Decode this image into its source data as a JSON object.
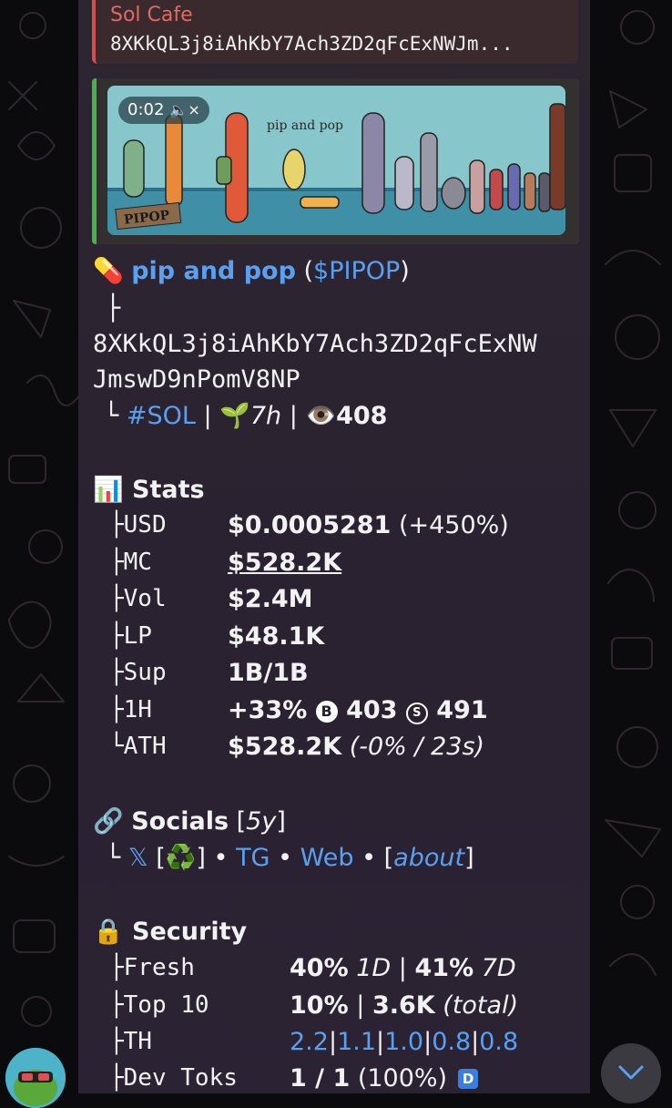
{
  "reply": {
    "name": "Sol Cafe",
    "text": "8XKkQL3j8iAhKbY7Ach3ZD2qFcExNWJm..."
  },
  "media": {
    "duration": "0:02",
    "mute_glyph": "🔈×",
    "image_caption": "pip and pop",
    "image_logo": "PIPOP"
  },
  "token": {
    "emoji": "💊",
    "name": "pip and pop",
    "open_paren": "(",
    "ticker": "$PIPOP",
    "close_paren": ")",
    "tree_first": "├",
    "address_line1": "8XKkQL3j8iAhKbY7Ach3ZD2qFcExNW",
    "address_line2": "JmswD9nPomV8NP",
    "tree_last": "└",
    "chain": "#SOL",
    "sep": "|",
    "age_emoji": "🌱",
    "age": "7h",
    "views_emoji": "👁️",
    "views": "408"
  },
  "stats": {
    "emoji": "📊",
    "title": "Stats",
    "rows": [
      {
        "branch": "├",
        "label": "USD",
        "value": "$0.0005281",
        "extra": "(+450%)"
      },
      {
        "branch": "├",
        "label": "MC",
        "value": "$528.2K",
        "extra": ""
      },
      {
        "branch": "├",
        "label": "Vol",
        "value": "$2.4M",
        "extra": ""
      },
      {
        "branch": "├",
        "label": "LP",
        "value": "$48.1K",
        "extra": ""
      },
      {
        "branch": "├",
        "label": "Sup",
        "value": "1B/1B",
        "extra": ""
      }
    ],
    "h1": {
      "branch": "├",
      "label": "1H",
      "change": "+33%",
      "buy_icon": "B",
      "buys": "403",
      "sell_icon": "S",
      "sells": "491"
    },
    "ath": {
      "branch": "└",
      "label": "ATH",
      "value": "$528.2K",
      "extra": "(-0% / 23s)"
    }
  },
  "socials": {
    "emoji": "🔗",
    "title": "Socials",
    "age_open": "[",
    "age": "5y",
    "age_close": "]",
    "branch": "└",
    "x": "𝕏",
    "recycle_open": "[",
    "recycle": "♻️",
    "recycle_close": "]",
    "dot": "•",
    "tg": "TG",
    "web": "Web",
    "about_open": "[",
    "about": "about",
    "about_close": "]"
  },
  "security": {
    "emoji": "🔒",
    "title": "Security",
    "fresh": {
      "branch": "├",
      "label": "Fresh",
      "v1": "40%",
      "p1": "1D",
      "sep": "|",
      "v2": "41%",
      "p2": "7D"
    },
    "top10": {
      "branch": "├",
      "label": "Top 10",
      "v1": "10%",
      "sep": "|",
      "v2": "3.6K",
      "note": "(total)"
    },
    "th": {
      "branch": "├",
      "label": "TH",
      "values": [
        "2.2",
        "1.1",
        "1.0",
        "0.8",
        "0.8"
      ],
      "sep": "|"
    },
    "dev": {
      "branch": "├",
      "label": "Dev Toks",
      "value": "1 / 1",
      "extra": "(100%)",
      "badge": "D"
    }
  },
  "colors": {
    "accent_link": "#5aa0f0",
    "reply_name": "#e06a62",
    "media_border": "#46b24a",
    "reply_border": "#d25050"
  },
  "icons": {
    "scroll": "chevron-down-icon",
    "avatar": "pepe-avatar"
  }
}
